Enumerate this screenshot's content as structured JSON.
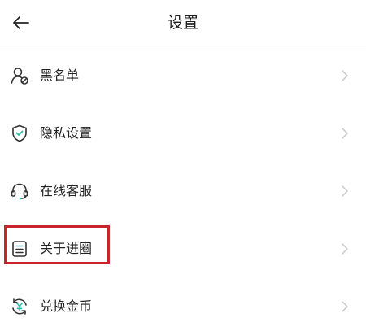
{
  "header": {
    "back_icon": "arrow-left-icon",
    "title": "设置"
  },
  "menu": {
    "items": [
      {
        "label": "黑名单",
        "icon": "user-block-icon"
      },
      {
        "label": "隐私设置",
        "icon": "shield-check-icon"
      },
      {
        "label": "在线客服",
        "icon": "headset-icon"
      },
      {
        "label": "关于进圈",
        "icon": "document-icon"
      },
      {
        "label": "兑换金币",
        "icon": "yuan-exchange-icon"
      }
    ],
    "chevron_icon": "chevron-right-icon",
    "chevron_color": "#c8c8c8"
  },
  "highlight": {
    "target": "关于进圈",
    "color": "#c8262c"
  }
}
